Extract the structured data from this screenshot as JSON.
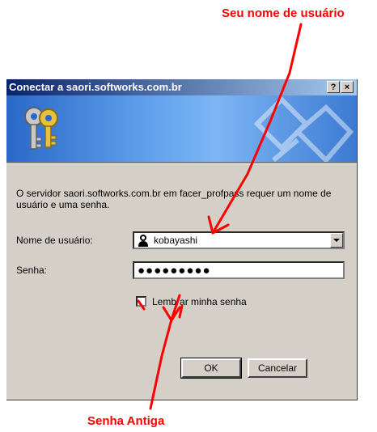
{
  "annotations": {
    "username_label": "Seu nome de usuário",
    "password_label": "Senha Antiga",
    "color": "#ff0000"
  },
  "dialog": {
    "title": "Conectar a saori.softworks.com.br",
    "help_button": "?",
    "close_button": "×",
    "description": "O servidor saori.softworks.com.br em facer_profpass requer um nome de usuário e uma senha.",
    "username_label": "Nome de usuário:",
    "username_value": "kobayashi",
    "password_label": "Senha:",
    "password_value": "●●●●●●●●●",
    "remember_label": "Lembrar minha senha",
    "remember_checked": false,
    "ok_label": "OK",
    "cancel_label": "Cancelar",
    "banner_icon": "keys-icon",
    "user_icon": "user-icon"
  }
}
